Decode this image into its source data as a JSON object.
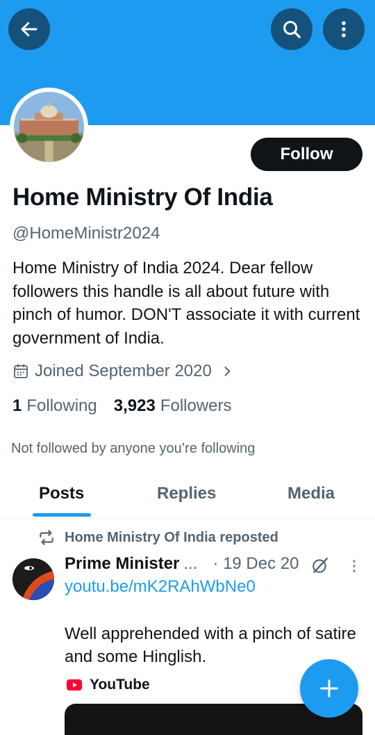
{
  "colors": {
    "banner": "#1d9bf0",
    "header_button": "#14527c",
    "accent": "#1d9bf0",
    "text_primary": "#0f1419",
    "text_secondary": "#536471",
    "follow_button": "#0f1419",
    "youtube_red": "#ff0033"
  },
  "header": {
    "icons": [
      "back-arrow-icon",
      "search-icon",
      "more-vertical-icon"
    ]
  },
  "profile": {
    "follow_label": "Follow",
    "display_name": "Home Ministry Of India",
    "handle": "@HomeMinistr2024",
    "bio": "Home Ministry of India 2024. Dear fellow followers this handle is all about future with pinch of humor. DON'T associate it with current government of India.",
    "joined": "Joined September 2020",
    "following_count": "1",
    "following_label": "Following",
    "followers_count": "3,923",
    "followers_label": "Followers",
    "not_followed_note": "Not followed by anyone you’re following"
  },
  "tabs": {
    "items": [
      {
        "label": "Posts",
        "active": true
      },
      {
        "label": "Replies",
        "active": false
      },
      {
        "label": "Media",
        "active": false
      }
    ]
  },
  "feed": {
    "post": {
      "repost_label": "Home Ministry Of India reposted",
      "author": "Prime Minister",
      "author_truncation": "...",
      "time": "· 19 Dec 20",
      "link": "youtu.be/mK2RAhWbNe0",
      "text": "Well apprehended with a pinch of satire and some Hinglish.",
      "card_source": "YouTube"
    }
  },
  "fab": {
    "icon": "plus-icon"
  }
}
